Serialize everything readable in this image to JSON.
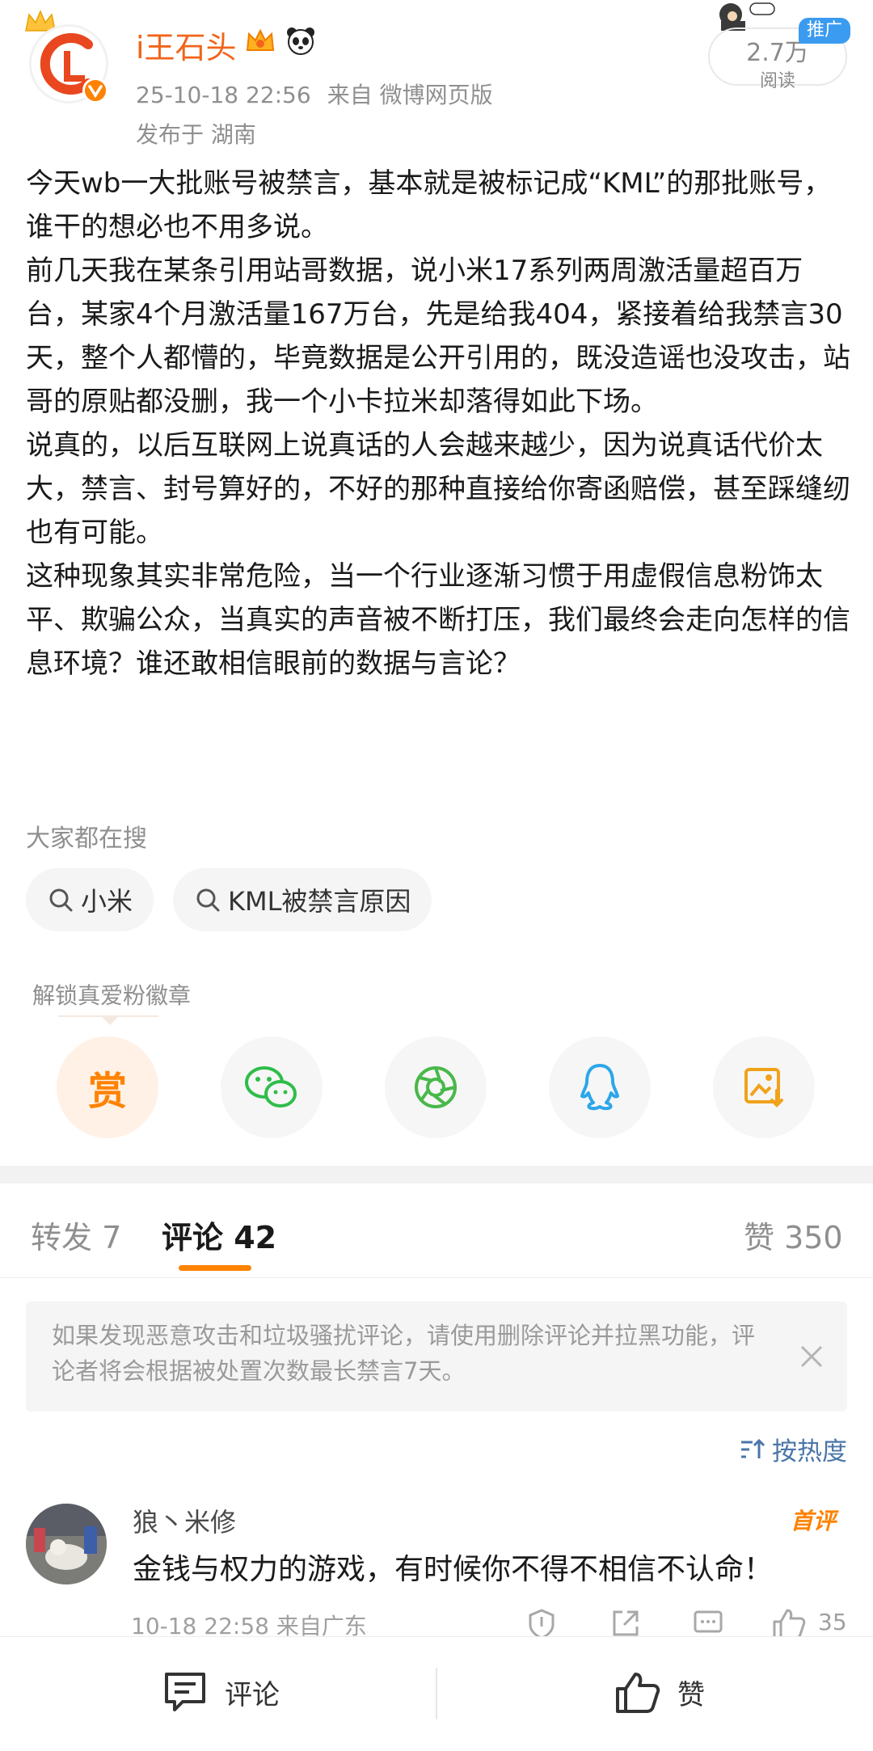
{
  "post": {
    "author": "i王石头",
    "time": "25-10-18 22:56",
    "source": "来自 微博网页版",
    "location": "发布于 湖南",
    "read_count": "2.7万",
    "read_label": "阅读",
    "promo_label": "推广",
    "paragraphs": [
      "今天wb一大批账号被禁言，基本就是被标记成“KML”的那批账号，谁干的想必也不用多说。",
      "前几天我在某条引用站哥数据，说小米17系列两周激活量超百万台，某家4个月激活量167万台，先是给我404，紧接着给我禁言30天，整个人都懵的，毕竟数据是公开引用的，既没造谣也没攻击，站哥的原贴都没删，我一个小卡拉米却落得如此下场。",
      "说真的，以后互联网上说真话的人会越来越少，因为说真话代价太大，禁言、封号算好的，不好的那种直接给你寄函赔偿，甚至踩缝纫也有可能。",
      "这种现象其实非常危险，当一个行业逐渐习惯于用虚假信息粉饰太平、欺骗公众，当真实的声音被不断打压，我们最终会走向怎样的信息环境？谁还敢相信眼前的数据与言论？"
    ]
  },
  "hot_search": {
    "label": "大家都在搜",
    "chips": [
      "小米",
      "KML被禁言原因"
    ]
  },
  "share": {
    "unlock_label": "解锁真爱粉徽章",
    "reward_label": "赏",
    "icons": [
      "reward-icon",
      "wechat-icon",
      "moments-icon",
      "qq-icon",
      "save-image-icon"
    ]
  },
  "tabs": {
    "repost": "转发 7",
    "comment": "评论 42",
    "like": "赞 350"
  },
  "notice": {
    "text": "如果发现恶意攻击和垃圾骚扰评论，请使用删除评论并拉黑功能，评论者将会根据被处置次数最长禁言7天。"
  },
  "sort": {
    "label": "按热度"
  },
  "comment": {
    "name": "狼丶米修",
    "badge": "首评",
    "text": "金钱与权力的游戏，有时候你不得不相信不认命！",
    "meta": "10-18 22:58 来自广东",
    "like_count": "35"
  },
  "bottom_bar": {
    "comment_label": "评论",
    "like_label": "赞"
  },
  "colors": {
    "accent": "#ff8200",
    "username": "#f2641a",
    "link": "#4a76a8",
    "muted": "#8f8f8f"
  }
}
